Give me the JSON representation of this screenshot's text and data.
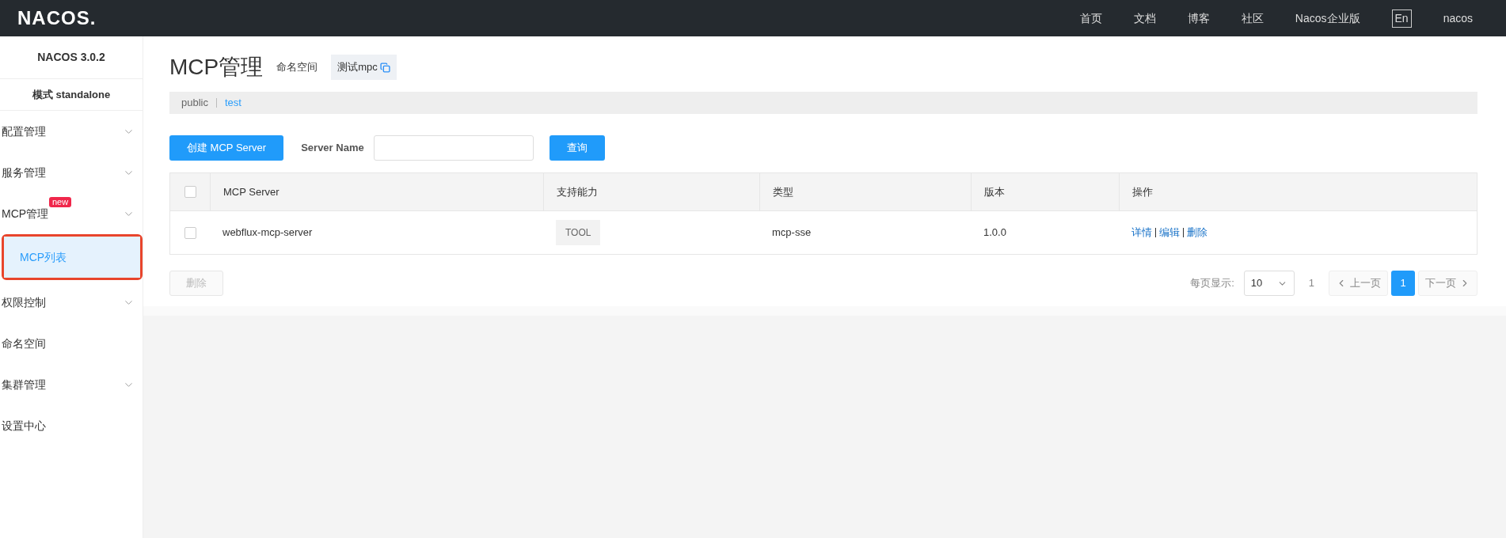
{
  "topbar": {
    "logo": "NACOS.",
    "nav": [
      {
        "label": "首页",
        "kind": "link"
      },
      {
        "label": "文档",
        "kind": "link"
      },
      {
        "label": "博客",
        "kind": "link"
      },
      {
        "label": "社区",
        "kind": "link"
      },
      {
        "label": "Nacos企业版",
        "kind": "link"
      },
      {
        "label": "En",
        "kind": "lang"
      },
      {
        "label": "nacos",
        "kind": "link"
      }
    ]
  },
  "sidebar": {
    "title": "NACOS 3.0.2",
    "mode": "模式 standalone",
    "items": [
      {
        "label": "配置管理",
        "expandable": true
      },
      {
        "label": "服务管理",
        "expandable": true
      },
      {
        "label": "MCP管理",
        "expandable": true,
        "badge": "new",
        "children": [
          {
            "label": "MCP列表",
            "selected": true
          }
        ]
      },
      {
        "label": "权限控制",
        "expandable": true
      },
      {
        "label": "命名空间",
        "expandable": false
      },
      {
        "label": "集群管理",
        "expandable": true
      },
      {
        "label": "设置中心",
        "expandable": false
      }
    ]
  },
  "page": {
    "title": "MCP管理",
    "namespace_label": "命名空间",
    "namespace_value": "测试mpc",
    "namespaces": [
      {
        "label": "public",
        "selected": false
      },
      {
        "label": "test",
        "selected": true
      }
    ]
  },
  "toolbar": {
    "create_button": "创建 MCP Server",
    "field_label": "Server Name",
    "search_button": "查询"
  },
  "table": {
    "select_all_checked": false,
    "columns": [
      "MCP Server",
      "支持能力",
      "类型",
      "版本",
      "操作"
    ],
    "rows": [
      {
        "checked": false,
        "name": "webflux-mcp-server",
        "capability": "TOOL",
        "type": "mcp-sse",
        "version": "1.0.0",
        "actions": [
          "详情",
          "编辑",
          "删除"
        ]
      }
    ]
  },
  "footer": {
    "delete_button": "删除",
    "page_size_label": "每页显示:",
    "page_size": "10",
    "total": "1",
    "prev": "上一页",
    "pages": [
      {
        "label": "1",
        "selected": true
      }
    ],
    "next": "下一页"
  }
}
